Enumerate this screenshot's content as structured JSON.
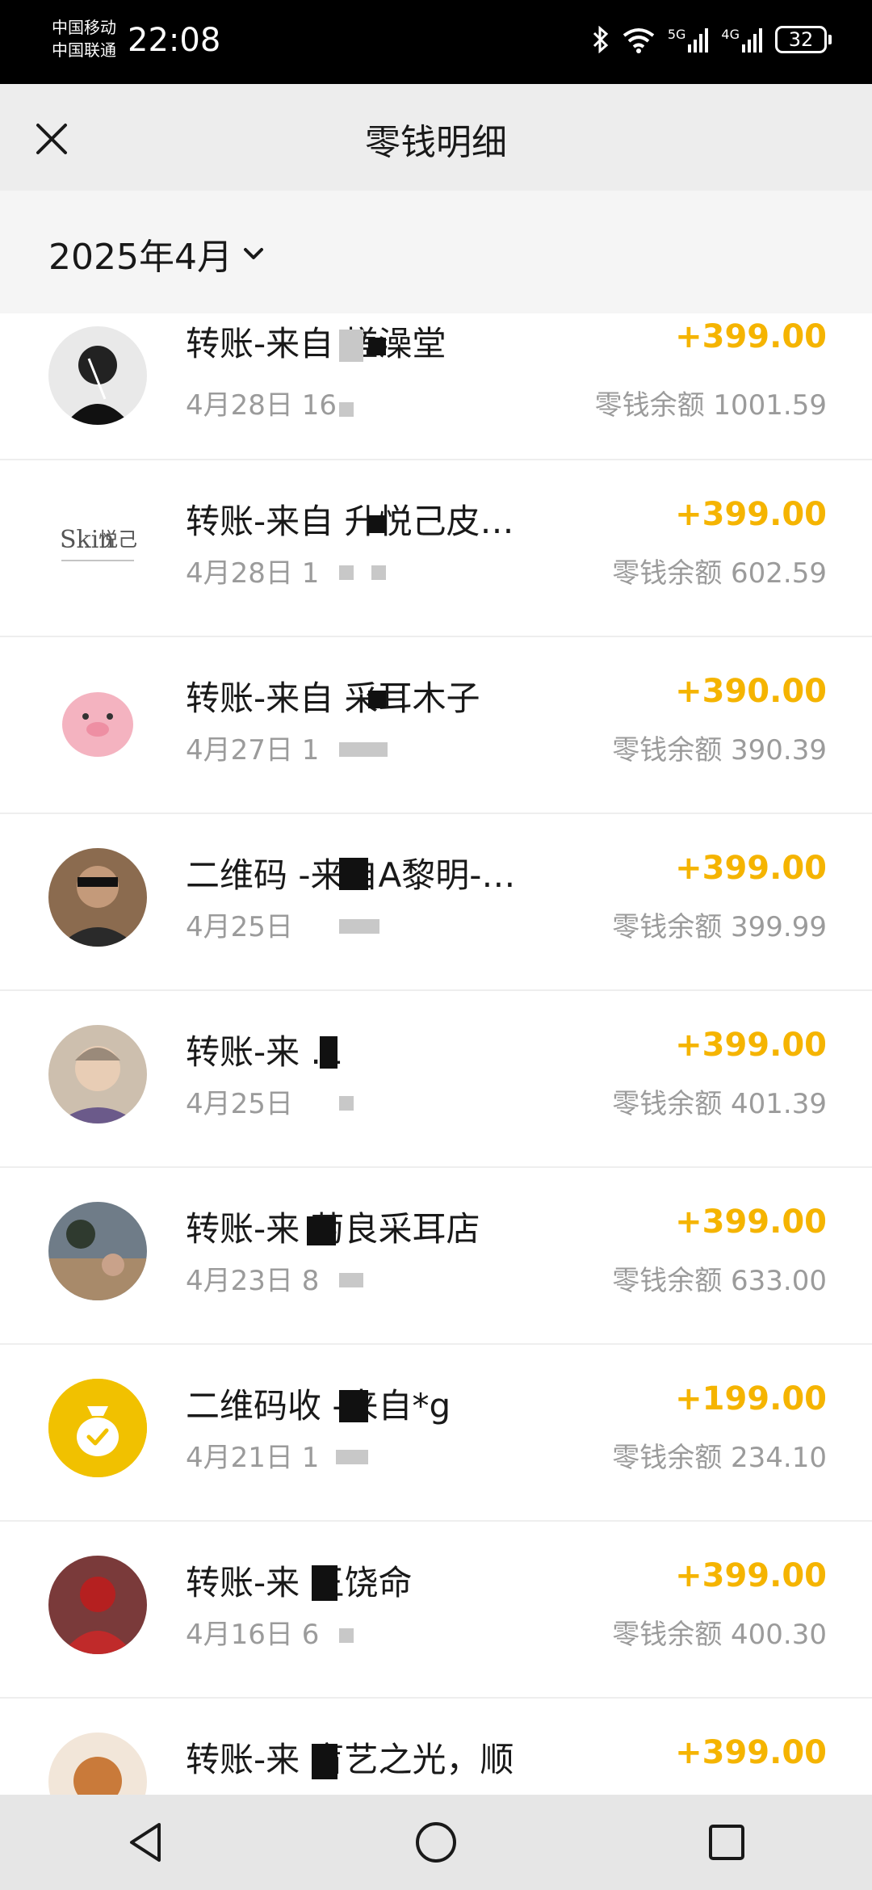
{
  "status_bar": {
    "carrier_1": "中国移动",
    "carrier_2": "中国联通",
    "time": "22:08",
    "network_1": "5G",
    "network_2": "4G",
    "battery": "32"
  },
  "header": {
    "title": "零钱明细",
    "close_icon": "close-icon"
  },
  "filter": {
    "month": "2025年4月",
    "dropdown_icon": "chevron-down-icon"
  },
  "transactions": [
    {
      "title": "转账-来自 搓澡堂",
      "date": "4月28日 16",
      "amount": "+399.00",
      "balance": "零钱余额 1001.59"
    },
    {
      "title": "转账-来自 升悦己皮…",
      "date": "4月28日 1",
      "amount": "+399.00",
      "balance": "零钱余额 602.59"
    },
    {
      "title": "转账-来自 采耳木子",
      "date": "4月27日 1",
      "amount": "+390.00",
      "balance": "零钱余额 390.39"
    },
    {
      "title": "二维码 -来自A黎明-…",
      "date": "4月25日",
      "amount": "+399.00",
      "balance": "零钱余额 399.99"
    },
    {
      "title": "转账-来 .L",
      "date": "4月25日",
      "amount": "+399.00",
      "balance": "零钱余额 401.39"
    },
    {
      "title": "转账-来 菊良采耳店",
      "date": "4月23日 8",
      "amount": "+399.00",
      "balance": "零钱余额 633.00"
    },
    {
      "title": "二维码收 -来自*g",
      "date": "4月21日 1",
      "amount": "+199.00",
      "balance": "零钱余额 234.10"
    },
    {
      "title": "转账-来 王饶命",
      "date": "4月16日 6",
      "amount": "+399.00",
      "balance": "零钱余额 400.30"
    },
    {
      "title": "转账-来 盲艺之光，顺",
      "date": "",
      "amount": "+399.00",
      "balance": ""
    }
  ],
  "colors": {
    "amount": "#f5b400",
    "muted": "#9b9b9b",
    "title": "#191919"
  }
}
